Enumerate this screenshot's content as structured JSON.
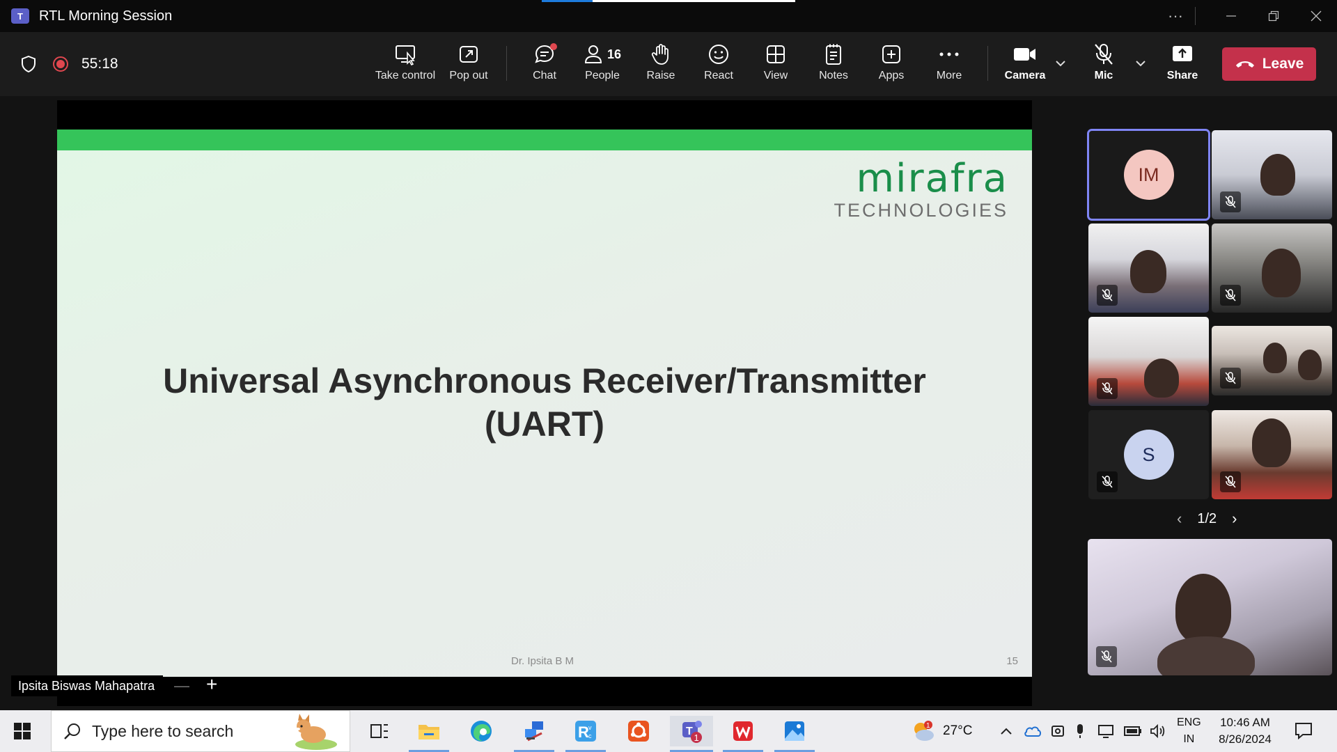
{
  "window": {
    "title": "RTL Morning Session",
    "more_label": "···"
  },
  "meeting": {
    "timer": "55:18",
    "call_progress": 0.2,
    "toolbar": {
      "take_control": "Take control",
      "pop_out": "Pop out",
      "chat": "Chat",
      "people": "People",
      "people_count": "16",
      "raise": "Raise",
      "react": "React",
      "view": "View",
      "notes": "Notes",
      "apps": "Apps",
      "more": "More",
      "camera": "Camera",
      "mic": "Mic",
      "share": "Share",
      "leave": "Leave"
    }
  },
  "slide": {
    "brand_name": "mirafra",
    "brand_sub": "TECHNOLOGIES",
    "heading_line1": "Universal Asynchronous Receiver/Transmitter",
    "heading_line2": "(UART)",
    "footer_author": "Dr. Ipsita B M",
    "page_number": "15"
  },
  "presenter": {
    "name": "Ipsita Biswas Mahapatra"
  },
  "gallery": {
    "avatars": [
      {
        "initials": "IM",
        "bg": "#f4c7c1",
        "fg": "#7a2a20"
      },
      {
        "initials": "S",
        "bg": "#c9d3ef",
        "fg": "#1d2b5a"
      }
    ],
    "pager": "1/2"
  },
  "colors": {
    "accent": "#7f85f5",
    "leave": "#c4314b",
    "record": "#e0474f",
    "slide_green": "#35c45a",
    "brand_green": "#1a8e4a"
  },
  "taskbar": {
    "search_placeholder": "Type here to search",
    "weather": "27°C",
    "weather_badge": "1",
    "teams_badge": "1",
    "lang_line1": "ENG",
    "lang_line2": "IN",
    "time": "10:46 AM",
    "date": "8/26/2024"
  }
}
